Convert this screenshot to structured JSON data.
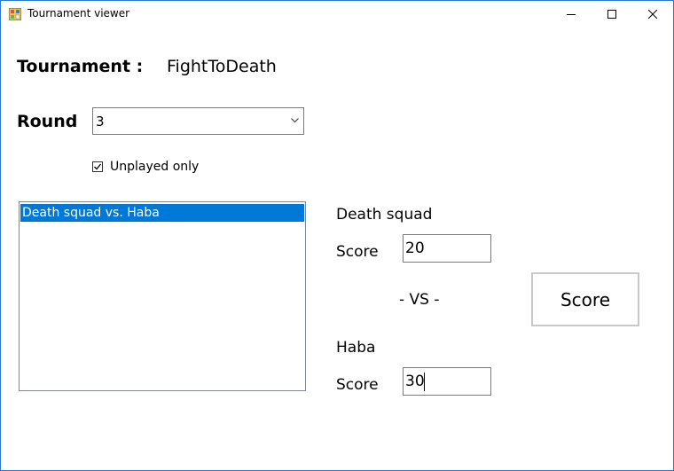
{
  "window": {
    "title": "Tournament viewer",
    "accent_color": "#2b78d0"
  },
  "tournament": {
    "label": "Tournament :",
    "name": "FightToDeath"
  },
  "round": {
    "label": "Round",
    "selected": "3"
  },
  "filter": {
    "unplayed_label": "Unplayed only",
    "unplayed_checked": true
  },
  "matchups": {
    "items": [
      "Death squad vs. Haba"
    ],
    "selected_index": 0,
    "selection_color": "#0078d7"
  },
  "match": {
    "team_one": {
      "name": "Death squad",
      "score_label": "Score",
      "score": "20"
    },
    "vs_label": "- VS -",
    "team_two": {
      "name": "Haba",
      "score_label": "Score",
      "score": "30"
    },
    "score_button_label": "Score"
  }
}
